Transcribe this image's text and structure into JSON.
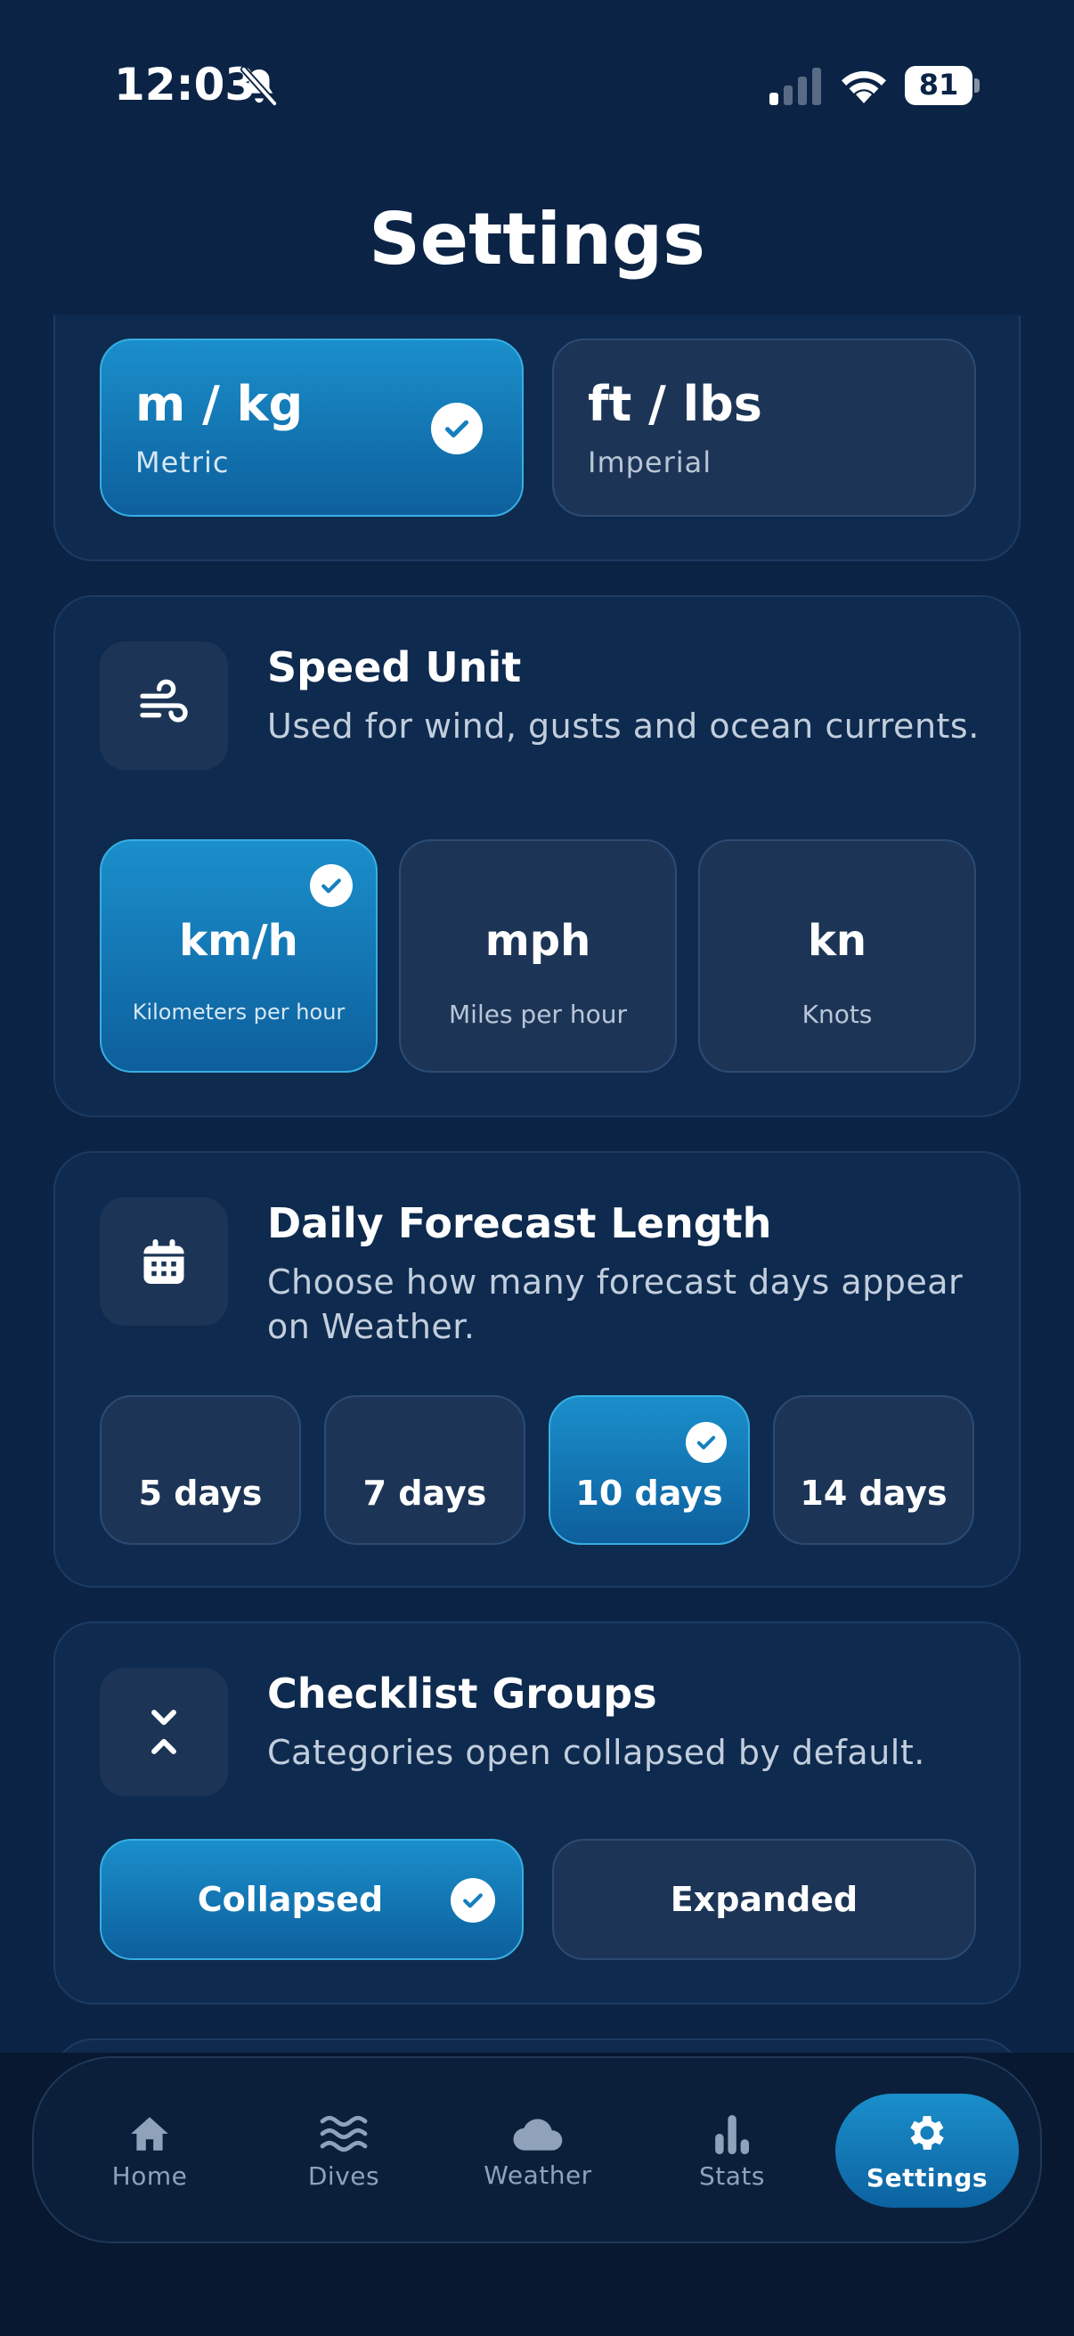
{
  "status_bar": {
    "time": "12:03",
    "battery": "81"
  },
  "header": {
    "title": "Settings"
  },
  "weight_unit": {
    "options": [
      {
        "title": "m / kg",
        "subtitle": "Metric",
        "selected": true
      },
      {
        "title": "ft / lbs",
        "subtitle": "Imperial",
        "selected": false
      }
    ]
  },
  "speed_unit": {
    "title": "Speed Unit",
    "description": "Used for wind, gusts and ocean currents.",
    "icon": "wind-icon",
    "options": [
      {
        "title": "km/h",
        "subtitle": "Kilometers per hour",
        "selected": true
      },
      {
        "title": "mph",
        "subtitle": "Miles per hour",
        "selected": false
      },
      {
        "title": "kn",
        "subtitle": "Knots",
        "selected": false
      }
    ]
  },
  "forecast_length": {
    "title": "Daily Forecast Length",
    "description": "Choose how many forecast days appear on Weather.",
    "icon": "calendar-icon",
    "options": [
      {
        "label": "5 days",
        "selected": false
      },
      {
        "label": "7 days",
        "selected": false
      },
      {
        "label": "10 days",
        "selected": true
      },
      {
        "label": "14 days",
        "selected": false
      }
    ]
  },
  "checklist_groups": {
    "title": "Checklist Groups",
    "description": "Categories open collapsed by default.",
    "icon": "collapse-icon",
    "options": [
      {
        "label": "Collapsed",
        "selected": true
      },
      {
        "label": "Expanded",
        "selected": false
      }
    ]
  },
  "tab_bar": {
    "items": [
      {
        "label": "Home",
        "icon": "home-icon",
        "active": false
      },
      {
        "label": "Dives",
        "icon": "waves-icon",
        "active": false
      },
      {
        "label": "Weather",
        "icon": "cloud-icon",
        "active": false
      },
      {
        "label": "Stats",
        "icon": "bar-chart-icon",
        "active": false
      },
      {
        "label": "Settings",
        "icon": "gear-icon",
        "active": true
      }
    ]
  },
  "colors": {
    "background": "#0b2446",
    "card": "#0e2a4e",
    "accent": "#1a8fcb",
    "muted_text": "#c2cedd"
  }
}
